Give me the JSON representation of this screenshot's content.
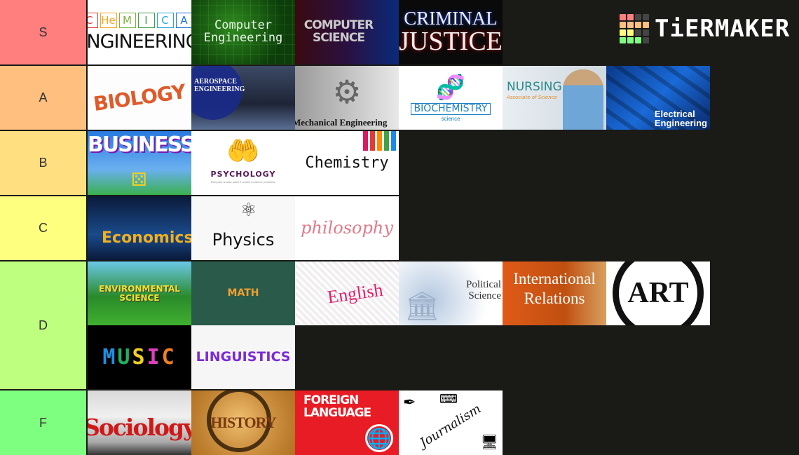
{
  "brand": {
    "logo_text": "TiERMAKER",
    "grid_colors": [
      "#ff7f7f",
      "#ff7f7f",
      "#444444",
      "#444444",
      "#ffbf7f",
      "#ffbf7f",
      "#ffbf7f",
      "#ffbf7f",
      "#ffff7f",
      "#ffff7f",
      "#444444",
      "#444444",
      "#7fff7f",
      "#7fff7f",
      "#7fff7f",
      "#444444"
    ]
  },
  "tiers": [
    {
      "label": "S",
      "color": "#ff7f7f",
      "items": [
        "Chemical Engineering",
        "Computer Engineering",
        "Computer Science",
        "Criminal Justice"
      ]
    },
    {
      "label": "A",
      "color": "#ffbf7f",
      "items": [
        "Biology",
        "Aerospace Engineering",
        "Mechanical Engineering",
        "Biochemistry",
        "Nursing",
        "Electrical Engineering"
      ]
    },
    {
      "label": "B",
      "color": "#ffdf7f",
      "items": [
        "Business",
        "Psychology",
        "Chemistry"
      ]
    },
    {
      "label": "C",
      "color": "#ffff7f",
      "items": [
        "Economics",
        "Physics",
        "Philosophy"
      ]
    },
    {
      "label": "D",
      "color": "#bfff7f",
      "items": [
        "Environmental Science",
        "Math",
        "English",
        "Political Science",
        "International Relations",
        "Art",
        "Music",
        "Linguistics"
      ]
    },
    {
      "label": "F",
      "color": "#7fff7f",
      "items": [
        "Sociology",
        "History",
        "Foreign Language",
        "Journalism"
      ]
    }
  ],
  "tiles": {
    "cheme": {
      "elements": [
        "C",
        "He",
        "M",
        "I",
        "C",
        "A"
      ],
      "element_colors": [
        "#e53935",
        "#f5a623",
        "#7cb342",
        "#43a047",
        "#29a3e0",
        "#1e6fd9"
      ],
      "text": "NGINEERING"
    },
    "compeng": {
      "l1": "Computer",
      "l2": "Engineering"
    },
    "compsci": {
      "l1": "COMPUTER",
      "l2": "SCIENCE"
    },
    "crim": {
      "l1": "CRIMINAL",
      "l2": "JUSTICE"
    },
    "bio": {
      "text": "BIOLOGY"
    },
    "aero": {
      "l1": "AEROSPACE",
      "l2": "ENGINEERING"
    },
    "mech": {
      "text": "Mechanical Engineering"
    },
    "biochem": {
      "icon": "🧬",
      "l1": "BIOCHEMISTRY",
      "l2": "science"
    },
    "nursing": {
      "l1": "NURSING",
      "l2": "Associate of Science"
    },
    "elec": {
      "l1": "Electrical",
      "l2": "Engineering"
    },
    "biz": {
      "text": "BUSINESS"
    },
    "psych": {
      "icon": "🤲",
      "l1": "PSYCHOLOGY",
      "l2": "Everyone is wise when it comes to others' problems."
    },
    "chem": {
      "text": "Chemistry",
      "tube_colors": [
        "#d81b60",
        "#e53935",
        "#fb8c00",
        "#43a047",
        "#1e88e5",
        "#8e24aa"
      ]
    },
    "econ": {
      "text": "Economics"
    },
    "phys": {
      "text": "Physics"
    },
    "philo": {
      "text": "philosophy"
    },
    "env": {
      "l1": "ENVIRONMENTAL",
      "l2": "SCIENCE"
    },
    "math": {
      "text": "MATH"
    },
    "eng": {
      "text": "English"
    },
    "polisci": {
      "l1": "Political",
      "l2": "Science"
    },
    "ir": {
      "l1": "International",
      "l2": "Relations"
    },
    "art": {
      "text": "ART"
    },
    "music": {
      "letters": [
        "M",
        "U",
        "S",
        "I",
        "C"
      ],
      "letter_colors": [
        "#1e90e0",
        "#20b060",
        "#f0d020",
        "#e040c0",
        "#f08020"
      ]
    },
    "ling": {
      "text": "LINGUISTICS"
    },
    "soc": {
      "text": "Sociology"
    },
    "hist": {
      "text": "HISTORY"
    },
    "foreign": {
      "l1": "FOREIGN",
      "l2": "LANGUAGE",
      "icon": "🌐"
    },
    "journ": {
      "text": "Journalism"
    }
  }
}
